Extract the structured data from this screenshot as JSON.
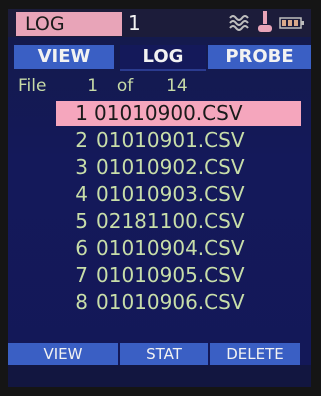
{
  "header": {
    "mode": "LOG",
    "file_number": "1",
    "icons": [
      "wave-icon",
      "probe-icon",
      "battery-icon"
    ]
  },
  "tabs": [
    {
      "label": "VIEW"
    },
    {
      "label": "LOG"
    },
    {
      "label": "PROBE"
    }
  ],
  "counter": {
    "label": "File",
    "current": "1",
    "of": "of",
    "total": "14"
  },
  "files": [
    {
      "index": "1",
      "name": "01010900.CSV",
      "selected": true
    },
    {
      "index": "2",
      "name": "01010901.CSV",
      "selected": false
    },
    {
      "index": "3",
      "name": "01010902.CSV",
      "selected": false
    },
    {
      "index": "4",
      "name": "01010903.CSV",
      "selected": false
    },
    {
      "index": "5",
      "name": "02181100.CSV",
      "selected": false
    },
    {
      "index": "6",
      "name": "01010904.CSV",
      "selected": false
    },
    {
      "index": "7",
      "name": "01010905.CSV",
      "selected": false
    },
    {
      "index": "8",
      "name": "01010906.CSV",
      "selected": false
    }
  ],
  "softkeys": [
    {
      "label": "VIEW"
    },
    {
      "label": "STAT"
    },
    {
      "label": "DELETE"
    }
  ],
  "colors": {
    "accent": "#3a5fc4",
    "selection": "#f5a6bd",
    "text": "#c8dea9",
    "background": "#14195a"
  }
}
